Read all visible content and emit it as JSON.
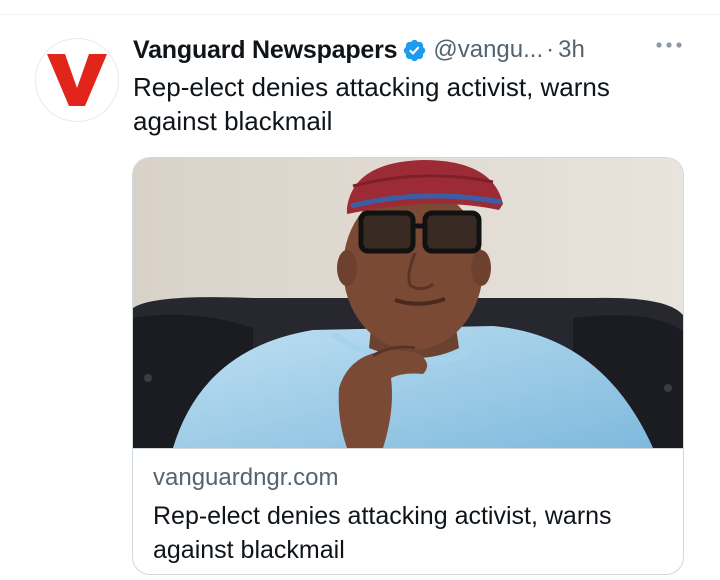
{
  "tweet": {
    "author_name": "Vanguard Newspapers",
    "author_handle": "@vangu...",
    "separator": "·",
    "timestamp": "3h",
    "text": "Rep-elect denies attacking activist, warns against blackmail",
    "avatar_logo": "V",
    "verified": true,
    "more_icon": "ellipsis-icon"
  },
  "link_card": {
    "domain": "vanguardngr.com",
    "title": "Rep-elect denies attacking activist, warns against blackmail",
    "image": "man-in-red-cap-and-glasses-photo"
  },
  "colors": {
    "brand_red": "#e1251b",
    "verified_blue": "#1d9bf0",
    "secondary_text": "#536471",
    "border": "#cfd9de"
  }
}
